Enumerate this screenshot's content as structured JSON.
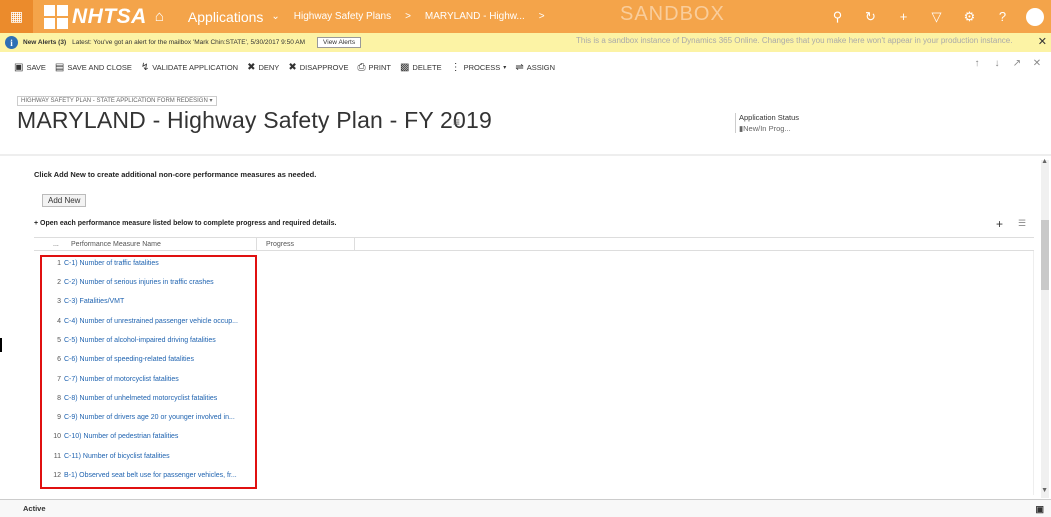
{
  "topbar": {
    "logo_text": "NHTSA",
    "applications_label": "Applications",
    "breadcrumb": [
      "Highway Safety Plans",
      "MARYLAND - Highw..."
    ],
    "sandbox_label": "SANDBOX"
  },
  "alerts": {
    "title": "New Alerts (3)",
    "message": "Latest: You've got an alert for the mailbox 'Mark Chin:STATE', 5/30/2017 9:50 AM",
    "view_button": "View Alerts",
    "sandbox_message": "This is a sandbox instance of Dynamics 365 Online. Changes that you make here won't appear in your production instance."
  },
  "commands": [
    {
      "label": "SAVE",
      "icon": "floppy-icon"
    },
    {
      "label": "SAVE AND CLOSE",
      "icon": "save-close-icon"
    },
    {
      "label": "VALIDATE APPLICATION",
      "icon": "validate-icon"
    },
    {
      "label": "DENY",
      "icon": "x-icon"
    },
    {
      "label": "DISAPPROVE",
      "icon": "x-icon"
    },
    {
      "label": "PRINT",
      "icon": "printer-icon"
    },
    {
      "label": "DELETE",
      "icon": "trash-icon"
    },
    {
      "label": "PROCESS",
      "icon": "process-icon"
    },
    {
      "label": "ASSIGN",
      "icon": "assign-icon"
    }
  ],
  "form": {
    "selector": "HIGHWAY SAFETY PLAN - STATE APPLICATION FORM REDESIGN",
    "title": "MARYLAND - Highway Safety Plan - FY 2019",
    "status_label": "Application Status",
    "status_value": "New/In Prog..."
  },
  "section": {
    "instruction": "Click Add New to create additional non-core performance measures as needed.",
    "add_new_label": "Add New",
    "grid_instruction": "Open each performance measure listed below to complete progress and required details.",
    "columns": [
      "Performance Measure Name",
      "Progress"
    ],
    "rows": [
      {
        "num": "1",
        "name": "C-1) Number of traffic fatalities"
      },
      {
        "num": "2",
        "name": "C-2) Number of serious injuries in traffic crashes"
      },
      {
        "num": "3",
        "name": "C-3) Fatalities/VMT"
      },
      {
        "num": "4",
        "name": "C-4) Number of unrestrained passenger vehicle occup..."
      },
      {
        "num": "5",
        "name": "C-5) Number of alcohol-impaired driving fatalities"
      },
      {
        "num": "6",
        "name": "C-6) Number of speeding-related fatalities"
      },
      {
        "num": "7",
        "name": "C-7) Number of motorcyclist fatalities"
      },
      {
        "num": "8",
        "name": "C-8) Number of unhelmeted motorcyclist fatalities"
      },
      {
        "num": "9",
        "name": "C-9) Number of drivers age 20 or younger involved in..."
      },
      {
        "num": "10",
        "name": "C-10) Number of pedestrian fatalities"
      },
      {
        "num": "11",
        "name": "C-11) Number of bicyclist fatalities"
      },
      {
        "num": "12",
        "name": "B-1) Observed seat belt use for passenger vehicles, fr..."
      }
    ]
  },
  "footer": {
    "status": "Active"
  },
  "colors": {
    "topbar": "#f4a44a",
    "link": "#1f63b0",
    "highlight": "#e01010",
    "alert": "#fcf3a5"
  }
}
